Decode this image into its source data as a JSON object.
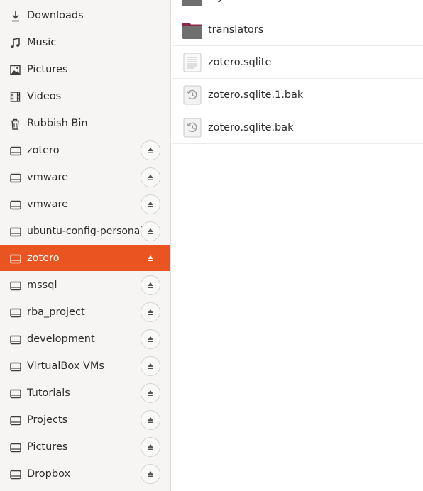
{
  "sidebar": {
    "places": [
      {
        "label": "Downloads",
        "icon": "download-icon"
      },
      {
        "label": "Music",
        "icon": "music-note-icon"
      },
      {
        "label": "Pictures",
        "icon": "image-icon"
      },
      {
        "label": "Videos",
        "icon": "film-icon"
      },
      {
        "label": "Rubbish Bin",
        "icon": "trash-icon"
      }
    ],
    "drives": [
      {
        "label": "zotero",
        "icon": "drive-icon",
        "eject_icon": "eject-icon"
      },
      {
        "label": "vmware",
        "icon": "drive-icon",
        "eject_icon": "eject-icon"
      },
      {
        "label": "vmware",
        "icon": "drive-icon",
        "eject_icon": "eject-icon"
      },
      {
        "label": "ubuntu-config-personal",
        "icon": "drive-icon",
        "eject_icon": "eject-icon"
      },
      {
        "label": "zotero",
        "icon": "drive-icon",
        "eject_icon": "eject-icon",
        "selected": true
      },
      {
        "label": "mssql",
        "icon": "drive-icon",
        "eject_icon": "eject-icon"
      },
      {
        "label": "rba_project",
        "icon": "drive-icon",
        "eject_icon": "eject-icon"
      },
      {
        "label": "development",
        "icon": "drive-icon",
        "eject_icon": "eject-icon"
      },
      {
        "label": "VirtualBox VMs",
        "icon": "drive-icon",
        "eject_icon": "eject-icon"
      },
      {
        "label": "Tutorials",
        "icon": "drive-icon",
        "eject_icon": "eject-icon"
      },
      {
        "label": "Projects",
        "icon": "drive-icon",
        "eject_icon": "eject-icon"
      },
      {
        "label": "Pictures",
        "icon": "drive-icon",
        "eject_icon": "eject-icon"
      },
      {
        "label": "Dropbox",
        "icon": "drive-icon",
        "eject_icon": "eject-icon"
      }
    ]
  },
  "files": [
    {
      "name": "styles",
      "icon": "folder-icon"
    },
    {
      "name": "translators",
      "icon": "folder-icon"
    },
    {
      "name": "zotero.sqlite",
      "icon": "text-document-icon"
    },
    {
      "name": "zotero.sqlite.1.bak",
      "icon": "backup-file-icon"
    },
    {
      "name": "zotero.sqlite.bak",
      "icon": "backup-file-icon"
    }
  ],
  "colors": {
    "accent": "#e95420",
    "sidebar_bg": "#f6f5f4",
    "folder_body": "#6f6f6f",
    "folder_tab": "#8a2846"
  }
}
